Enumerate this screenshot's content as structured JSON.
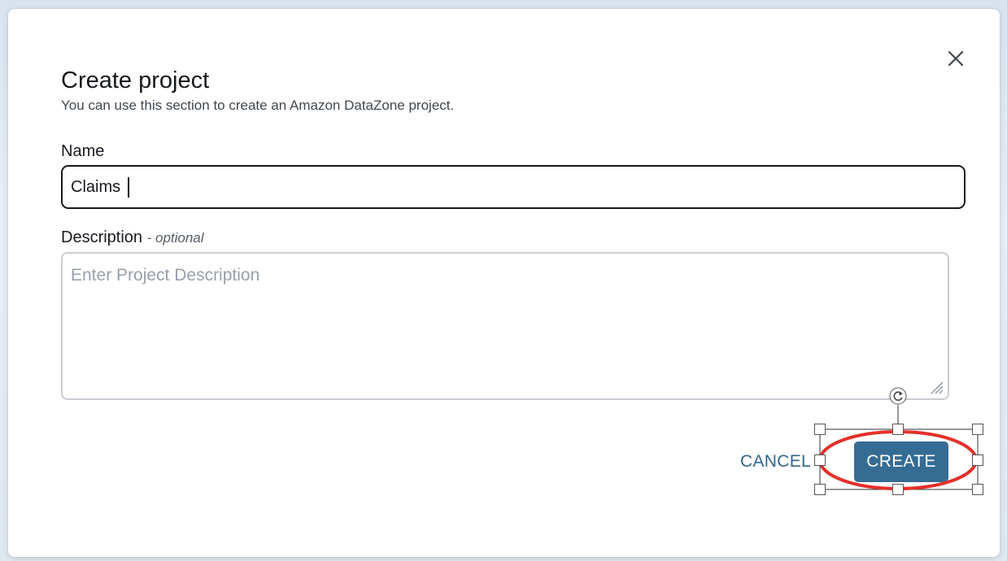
{
  "dialog": {
    "title": "Create project",
    "subtitle": "You can use this section to create an Amazon DataZone project."
  },
  "form": {
    "name_label": "Name",
    "name_value": "Claims",
    "description_label": "Description",
    "description_optional": "- optional",
    "description_placeholder": "Enter Project Description"
  },
  "actions": {
    "cancel_label": "CANCEL",
    "create_label": "CREATE"
  },
  "icons": {
    "close": "close-icon",
    "resize": "resize-grip-icon",
    "rotate": "rotate-handle-icon"
  },
  "colors": {
    "primary": "#356c93",
    "link": "#30678f",
    "annotation": "#e5302a"
  }
}
